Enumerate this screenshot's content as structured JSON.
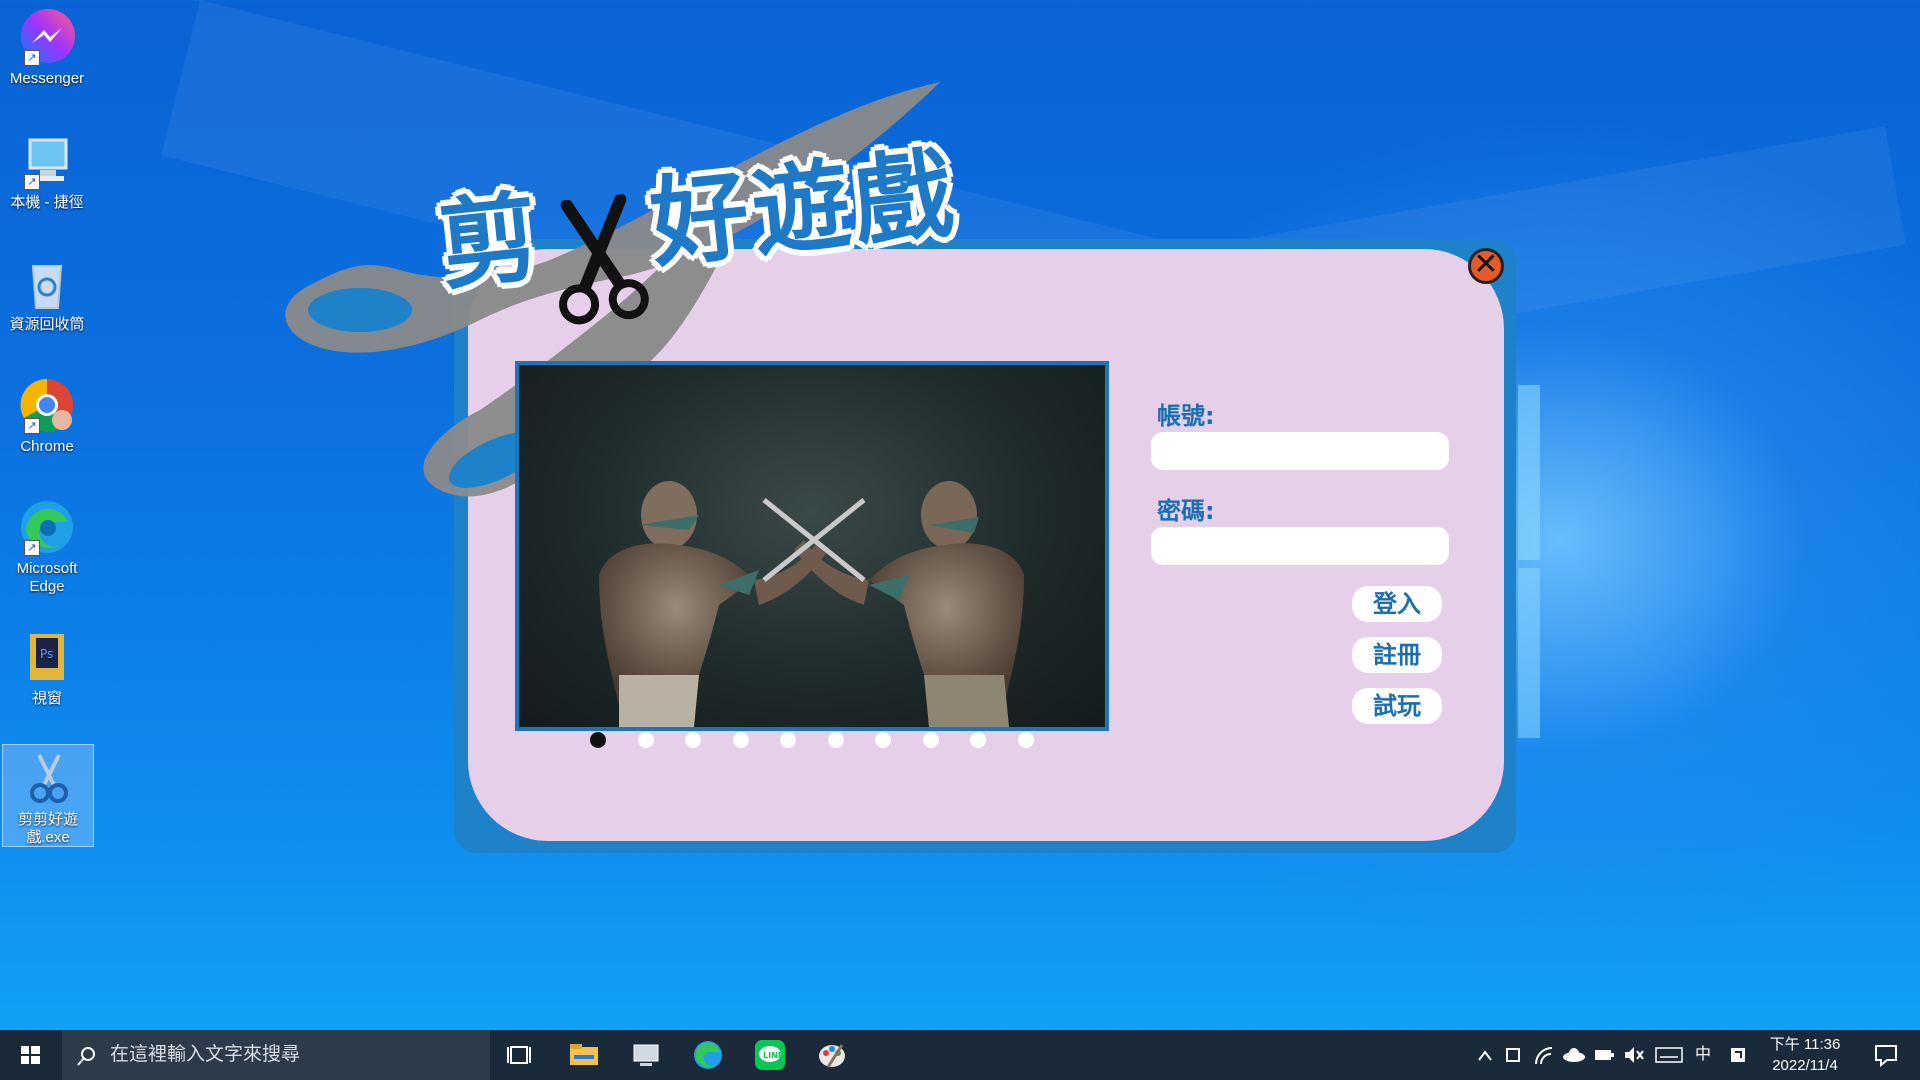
{
  "desktop": {
    "icons": [
      {
        "label": "Messenger",
        "icon": "messenger-icon"
      },
      {
        "label": "本機 - 捷徑",
        "icon": "this-pc-icon"
      },
      {
        "label": "資源回收筒",
        "icon": "recycle-bin-icon"
      },
      {
        "label": "Chrome",
        "icon": "chrome-icon"
      },
      {
        "label": "Microsoft Edge",
        "icon": "edge-icon"
      },
      {
        "label": "視窗",
        "icon": "folder-icon"
      },
      {
        "label": "剪剪好遊戲.exe",
        "icon": "scissors-icon"
      }
    ]
  },
  "game": {
    "title_left": "剪",
    "title_right": "好遊戲",
    "close_symbol": "✕",
    "account_label": "帳號:",
    "password_label": "密碼:",
    "account_value": "",
    "password_value": "",
    "buttons": {
      "login": "登入",
      "register": "註冊",
      "trial": "試玩"
    },
    "carousel": {
      "total": 10,
      "active_index": 0
    },
    "colors": {
      "frame": "#1d82c9",
      "panel": "#e6cfe9",
      "accent": "#1b6fb1"
    }
  },
  "taskbar": {
    "search_placeholder": "在這裡輸入文字來搜尋",
    "tray": {
      "ime": "中",
      "expand": "^"
    },
    "clock": {
      "time": "下午 11:36",
      "date": "2022/11/4"
    }
  }
}
